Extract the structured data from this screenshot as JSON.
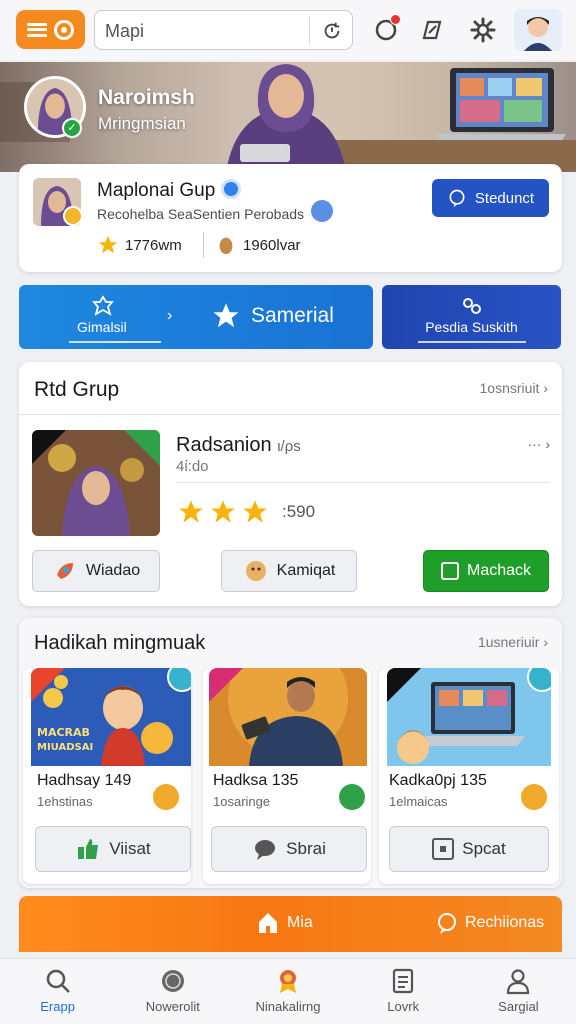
{
  "search": {
    "value": "Mapi"
  },
  "hero": {
    "name": "Naroimsh",
    "subtitle": "Mringmsian"
  },
  "profile": {
    "name": "Maplonai Gup",
    "description": "Recohelba SeaSentien Perobads",
    "stat_a": "1776wm",
    "stat_b": "1960lvar",
    "button_label": "Stedunct"
  },
  "actions": {
    "left_label": "Gimalsil",
    "main_label": "Samerial",
    "right_label": "Pesdia Suskith"
  },
  "group": {
    "title": "Rtd Grup",
    "link": "1osnsriuit",
    "item_name": "Radsanion",
    "item_tag": "ι/ρs",
    "item_sub": "4ί:do",
    "rating_text": ":590",
    "stars": 3,
    "buttons": [
      "Wiadao",
      "Kamiqat",
      "Machack"
    ]
  },
  "hadikah": {
    "title": "Hadikah mingmuak",
    "link": "1usneriuir",
    "tiles": [
      {
        "name": "Hadhsay 149",
        "sub": "1ehstinas",
        "button": "Viisat",
        "poster_line1": "MACRAB",
        "poster_line2": "MIUADSAI"
      },
      {
        "name": "Hadksa 135",
        "sub": "1osaringe",
        "button": "Sbrai"
      },
      {
        "name": "Kadka0pj 135",
        "sub": "1elmaicas",
        "button": "Spcat"
      }
    ]
  },
  "orange_bar": {
    "left_label": "Mia",
    "right_label": "Rechiionas"
  },
  "nav": [
    {
      "label": "Erapp",
      "icon": "search-icon",
      "active": true
    },
    {
      "label": "Nowerolit",
      "icon": "globe-icon",
      "active": false
    },
    {
      "label": "Ninakalirng",
      "icon": "award-icon",
      "active": false
    },
    {
      "label": "Lovrk",
      "icon": "document-icon",
      "active": false
    },
    {
      "label": "Sargial",
      "icon": "user-icon",
      "active": false
    }
  ],
  "colors": {
    "accent_orange": "#f58a1f",
    "primary_blue": "#1e88e0",
    "navy": "#2454c3",
    "success_green": "#1f9e2a",
    "nav_active": "#1f6fd6"
  }
}
